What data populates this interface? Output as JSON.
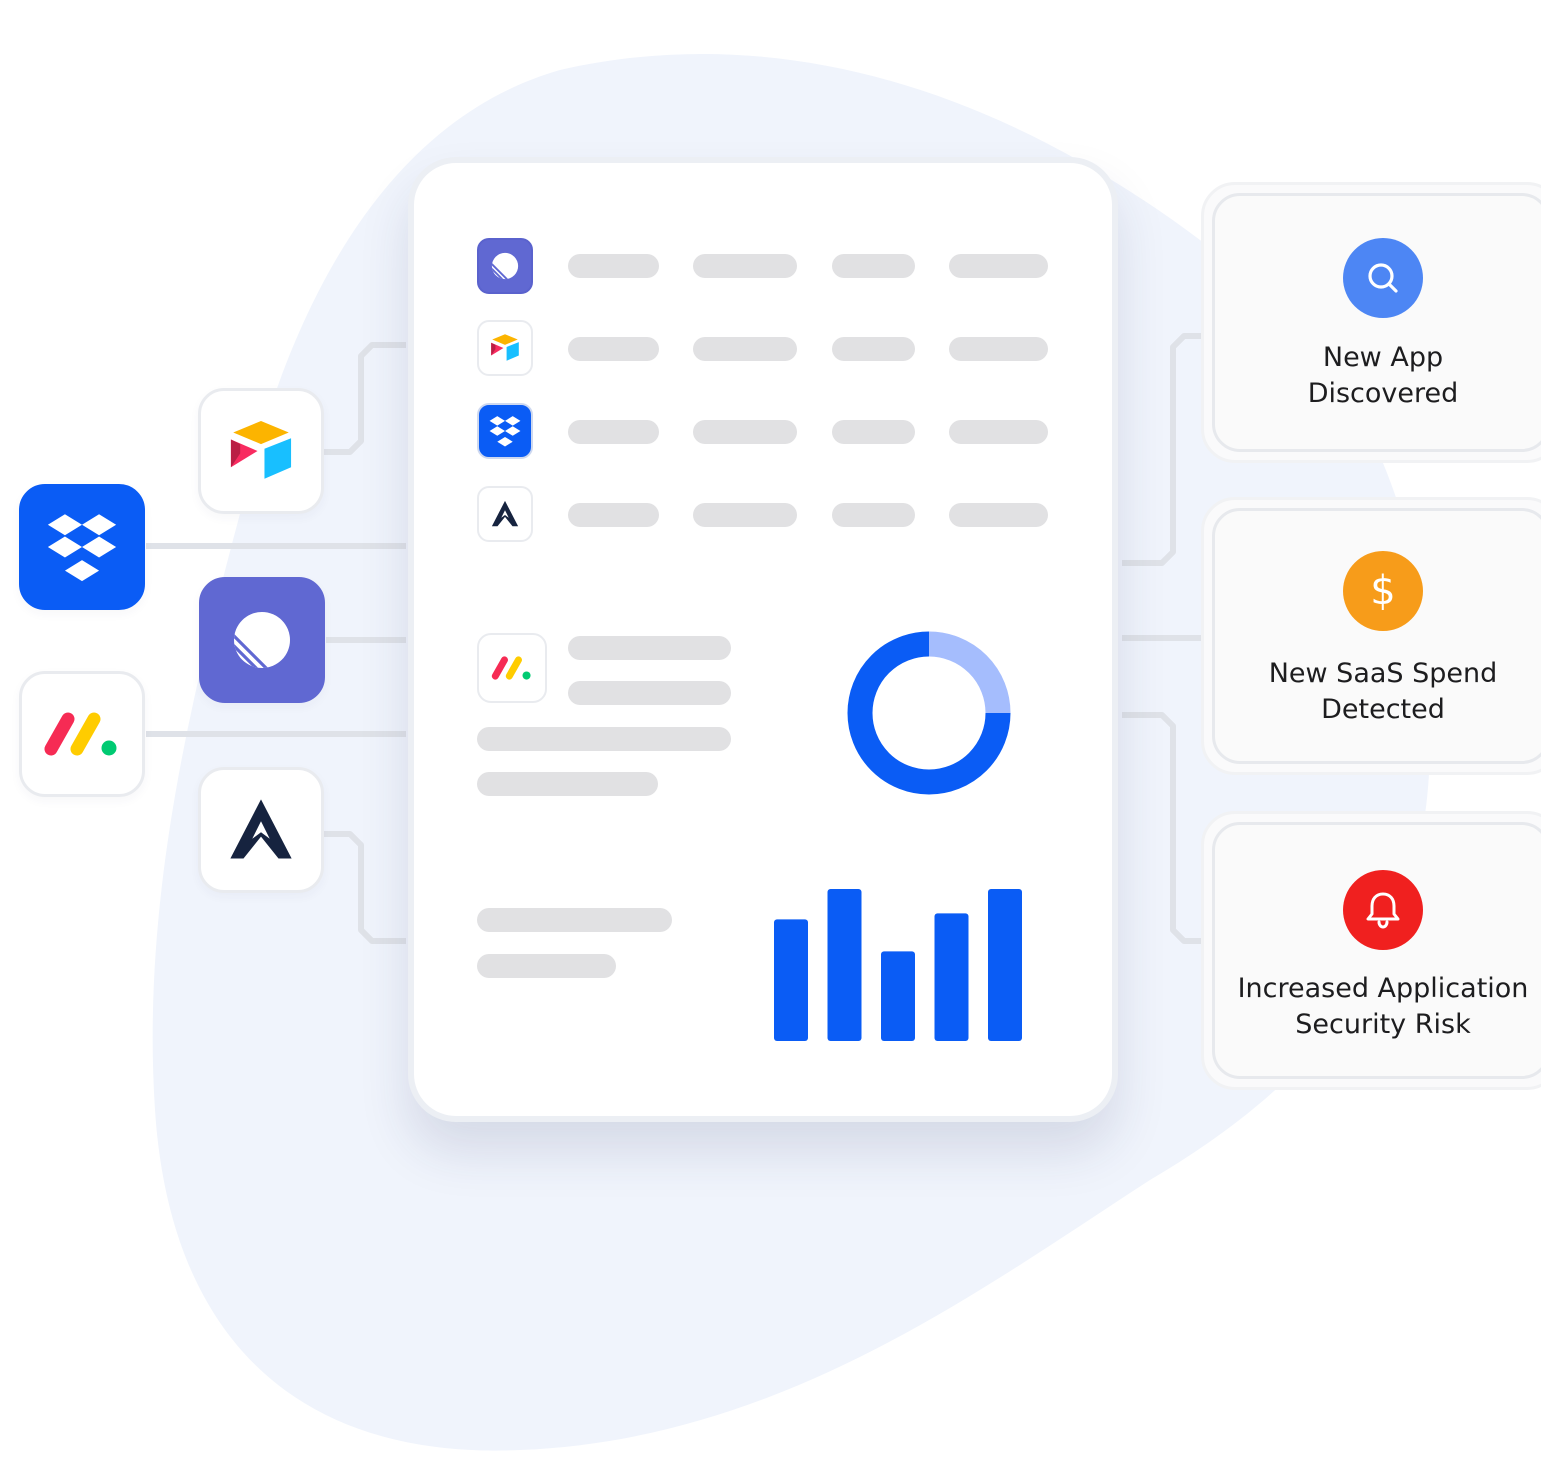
{
  "colors": {
    "primary_blue": "#0a5cf5",
    "light_blue": "#a5bdfd",
    "background_blob": "#f0f4fc",
    "linear_purple": "#6068d2",
    "placeholder_gray": "#e1e1e3",
    "search_blue": "#4d86f4",
    "spend_orange": "#f79c1a",
    "risk_red": "#f0201f"
  },
  "left_app_tiles": [
    {
      "icon": "dropbox-icon"
    },
    {
      "icon": "airtable-icon"
    },
    {
      "icon": "linear-icon"
    },
    {
      "icon": "monday-icon"
    },
    {
      "icon": "arcadia-icon"
    }
  ],
  "dashboard": {
    "app_rows": [
      {
        "icon": "linear-icon"
      },
      {
        "icon": "airtable-icon"
      },
      {
        "icon": "dropbox-icon"
      },
      {
        "icon": "arcadia-icon"
      }
    ],
    "detail_icon": "monday-icon",
    "donut_chart": {
      "type": "pie",
      "segments": [
        0.75,
        0.25
      ]
    },
    "bar_chart": {
      "type": "bar",
      "values": [
        0.8,
        1.0,
        0.59,
        0.84,
        1.0
      ]
    }
  },
  "alerts": [
    {
      "icon": "search-icon",
      "color": "#4d86f4",
      "text": "New App\nDiscovered"
    },
    {
      "icon": "dollar-icon",
      "color": "#f79c1a",
      "symbol": "$",
      "text": "New SaaS Spend\nDetected"
    },
    {
      "icon": "bell-icon",
      "color": "#f0201f",
      "text": "Increased Application\nSecurity Risk"
    }
  ]
}
